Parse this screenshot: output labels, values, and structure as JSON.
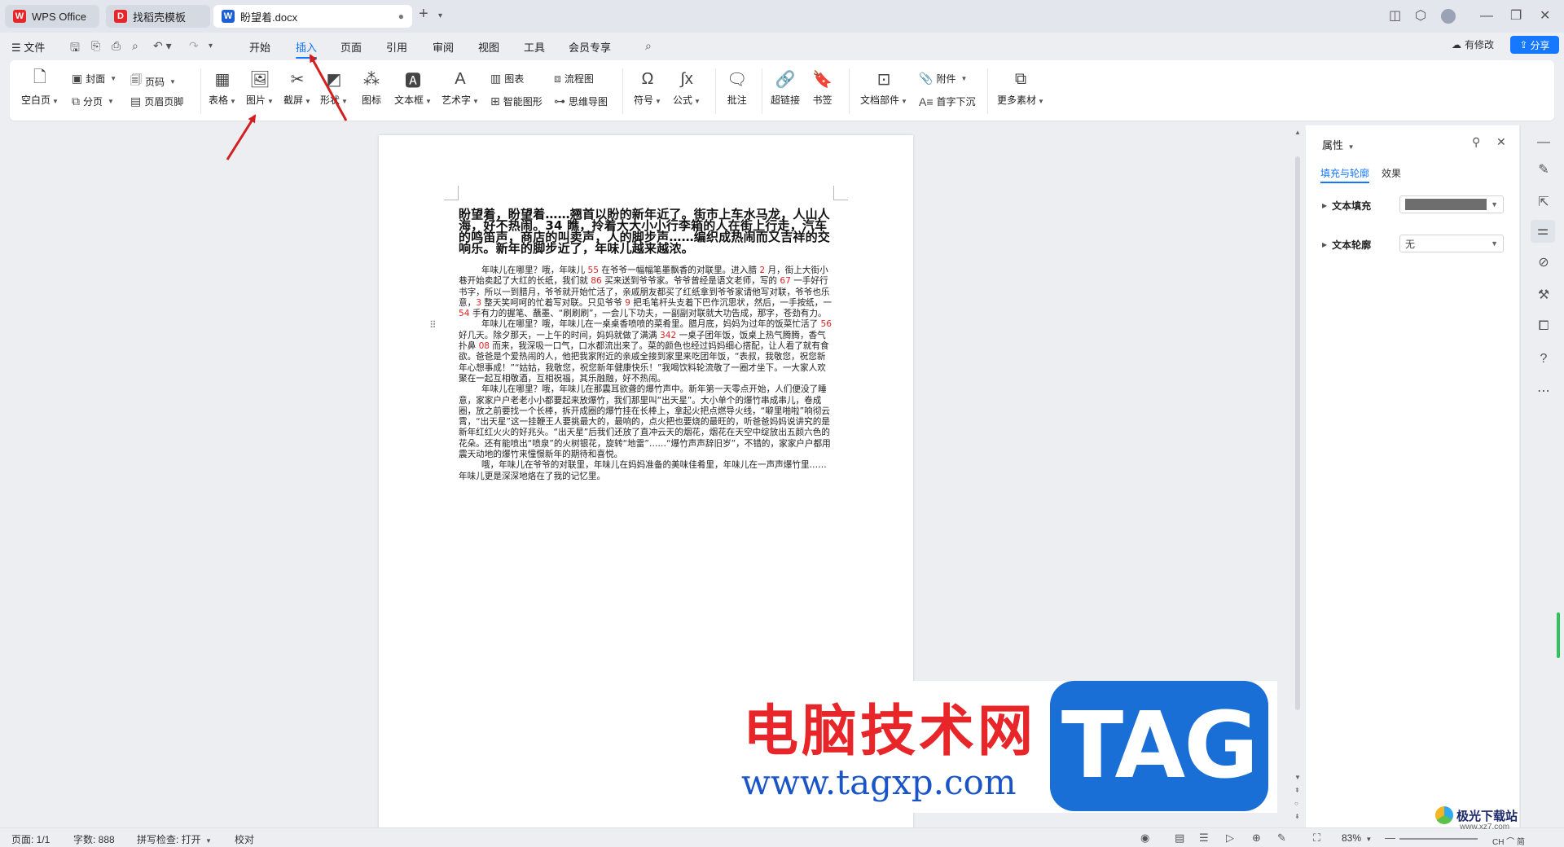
{
  "titlebar": {
    "tabs": [
      {
        "label": "WPS Office",
        "logo": "W",
        "color": "#e8262a"
      },
      {
        "label": "找稻壳模板",
        "logo": "D",
        "color": "#e8262a"
      },
      {
        "label": "盼望着.docx",
        "logo": "W",
        "color": "#1f5fd6"
      }
    ],
    "new_tab": "+",
    "window_buttons": [
      "layout-icon",
      "cube-icon",
      "avatar",
      "minimize-icon",
      "restore-icon",
      "close-icon"
    ]
  },
  "menubar": {
    "file": "文件",
    "items": [
      "开始",
      "插入",
      "页面",
      "引用",
      "审阅",
      "视图",
      "工具",
      "会员专享"
    ],
    "active": "插入",
    "modified": "有修改",
    "share": "分享"
  },
  "ribbon": {
    "blank_page": "空白页",
    "cover": "封面",
    "page_break": "分页",
    "page_number": "页码",
    "header_footer": "页眉页脚",
    "table": "表格",
    "picture": "图片",
    "screenshot": "截屏",
    "shape": "形状",
    "icons": "图标",
    "textbox": "文本框",
    "wordart": "艺术字",
    "chart": "图表",
    "smartart": "智能图形",
    "flowchart": "流程图",
    "mindmap": "思维导图",
    "symbol": "符号",
    "formula": "公式",
    "comment": "批注",
    "hyperlink": "超链接",
    "bookmark": "书签",
    "doc_parts": "文档部件",
    "attachment": "附件",
    "dropcap": "首字下沉",
    "more": "更多素材"
  },
  "document": {
    "heading": "盼望着，盼望着……翘首以盼的新年近了。街市上车水马龙，人山人海，好不热闹。34 瞧，拎着大大小小行李箱的人在街上行走，汽车的鸣笛声，商店的叫卖声，人的脚步声……编织成热闹而又吉祥的交响乐。新年的脚步近了，年味儿越来越浓。",
    "paragraphs": [
      [
        {
          "t": "年味儿在哪里？哦，年味儿 "
        },
        {
          "t": "55",
          "red": true
        },
        {
          "t": " 在爷爷一幅幅笔墨飘香的对联里。进入腊 "
        },
        {
          "t": "2",
          "red": true
        },
        {
          "t": " 月，街上大街小巷开始卖起了大红的长纸，我们就 "
        },
        {
          "t": "86",
          "red": true
        },
        {
          "t": " 买来送到爷爷家。爷爷曾经是语文老师，写的 "
        },
        {
          "t": "67",
          "red": true
        },
        {
          "t": " 一手好行书字，所以一到腊月，爷爷就开始忙活了，亲戚朋友都买了红纸拿到爷爷家请他写对联，爷爷也乐意，"
        },
        {
          "t": "3",
          "red": true
        },
        {
          "t": " 整天笑呵呵的忙着写对联。只见爷爷 "
        },
        {
          "t": "9",
          "red": true
        },
        {
          "t": " 把毛笔杆头支着下巴作沉思状，然后，一手按纸，一 "
        },
        {
          "t": "54",
          "red": true
        },
        {
          "t": " 手有力的握笔、蘸墨、“刷刷刷”，一会儿下功夫，一副副对联就大功告成，那字，苍劲有力。"
        }
      ],
      [
        {
          "t": "年味儿在哪里？哦，年味儿在一桌桌香喷喷的菜肴里。腊月底，妈妈为过年的饭菜忙活了 "
        },
        {
          "t": "56",
          "red": true
        },
        {
          "t": " 好几天。除夕那天，一上午的时间，妈妈就做了满满 "
        },
        {
          "t": "342",
          "red": true
        },
        {
          "t": " 一桌子团年饭，饭桌上热气腾腾，香气扑鼻 "
        },
        {
          "t": "08",
          "red": true
        },
        {
          "t": " 而来，我深吸一口气，口水都流出来了。菜的颜色也经过妈妈细心搭配，让人看了就有食欲。爸爸是个爱热闹的人，他把我家附近的亲戚全接到家里来吃团年饭，“表叔，我敬您，祝您新年心想事成！”“姑姑，我敬您，祝您新年健康快乐！”我喝饮料轮流敬了一圈才坐下。一大家人欢聚在一起互相敬酒，互相祝福，其乐融融，好不热闹。"
        }
      ],
      [
        {
          "t": "年味儿在哪里？哦，年味儿在那震耳欲聋的爆竹声中。新年第一天零点开始，人们便没了睡意，家家户户老老小小都要起来放爆竹，我们那里叫“出天星”。大小单个的爆竹串成串儿，卷成圈，放之前要找一个长棒，拆开成圈的爆竹挂在长棒上，拿起火把点燃导火线，“噼里啪啦”响彻云霄，“出天星”这一挂鞭王人要挑最大的，最响的，点火把也要烧的最旺的，听爸爸妈妈说讲究的是新年红红火火的好兆头。“出天星”后我们还放了直冲云天的烟花，烟花在天空中绽放出五颜六色的花朵。还有能喷出“喷泉”的火树银花，旋转“地雷”……“爆竹声声辞旧岁”，不错的，家家户户都用震天动地的爆竹来憧憬新年的期待和喜悦。"
        }
      ],
      [
        {
          "t": "哦，年味儿在爷爷的对联里，年味儿在妈妈准备的美味佳肴里，年味儿在一声声爆竹里……年味儿更是深深地烙在了我的记忆里。"
        }
      ]
    ]
  },
  "panel": {
    "title": "属性",
    "tabs": [
      "填充与轮廓",
      "效果"
    ],
    "text_fill": "文本填充",
    "text_outline": "文本轮廓",
    "outline_value": "无",
    "fill_color": "#6e6e6e"
  },
  "status": {
    "page": "页面: 1/1",
    "words": "字数: 888",
    "spell": "拼写检查: 打开",
    "proof": "校对",
    "zoom": "83%"
  },
  "watermark": {
    "cn": "电脑技术网",
    "url": "www.tagxp.com",
    "tag": "TAG",
    "brand": "极光下载站",
    "brand_sub": "www.xz7.com",
    "ime": "CH ⌒ 简"
  },
  "accent": "#1677ff",
  "annotation_color": "#d21f1f"
}
